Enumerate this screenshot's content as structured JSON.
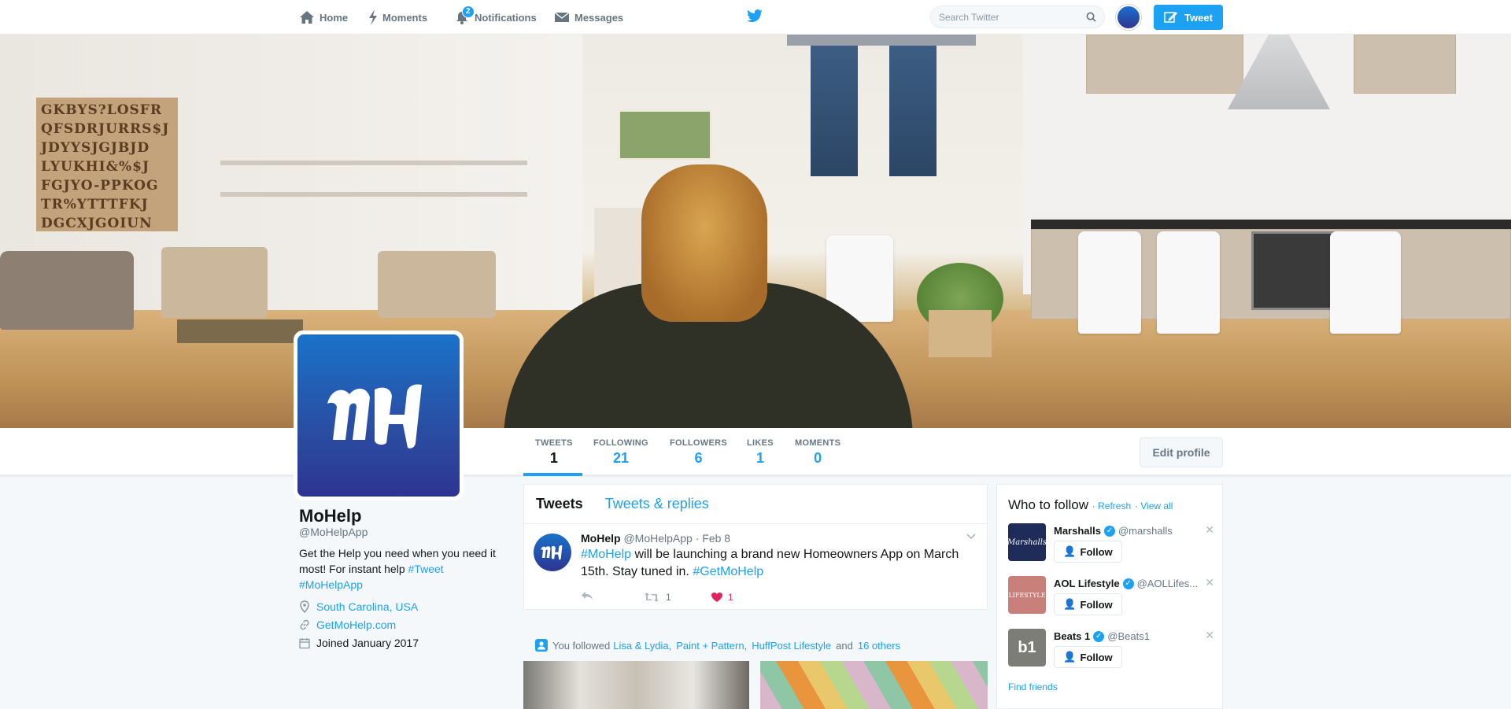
{
  "nav": {
    "home": "Home",
    "moments": "Moments",
    "notifications": "Notifications",
    "notifications_count": "2",
    "messages": "Messages",
    "search_placeholder": "Search Twitter",
    "tweet_button": "Tweet"
  },
  "banner": {
    "letter_art": "GKBYS?LOSFR QFSDRJURRS$J JDYYSJGJBJD LYUKHI&%$J FGJYO-PPKOG TR%YTTTFKJ DGCXJGOIUN"
  },
  "stats": [
    {
      "label": "TWEETS",
      "value": "1"
    },
    {
      "label": "FOLLOWING",
      "value": "21"
    },
    {
      "label": "FOLLOWERS",
      "value": "6"
    },
    {
      "label": "LIKES",
      "value": "1"
    },
    {
      "label": "MOMENTS",
      "value": "0"
    }
  ],
  "edit_profile": "Edit profile",
  "profile": {
    "name": "MoHelp",
    "handle": "@MoHelpApp",
    "bio_text": "Get the Help you need when you need it most! For instant help ",
    "bio_tag1": "#Tweet",
    "bio_tag2": "#MoHelpApp",
    "location": "South Carolina, USA",
    "website": "GetMoHelp.com",
    "joined": "Joined January 2017"
  },
  "timeline": {
    "tab_tweets": "Tweets",
    "tab_replies": "Tweets & replies",
    "tweet": {
      "name": "MoHelp",
      "handle": "@MoHelpApp",
      "date": "· Feb 8",
      "tag1": "#MoHelp",
      "text": " will be launching a brand new Homeowners App on March 15th. Stay tuned in. ",
      "tag2": "#GetMoHelp",
      "retweets": "1",
      "likes": "1"
    }
  },
  "followed": {
    "prefix": "You followed",
    "a": "Lisa & Lydia",
    "b": "Paint + Pattern",
    "c": "HuffPost Lifestyle",
    "and": "and",
    "others": "16 others"
  },
  "who_to_follow": {
    "title": "Who to follow",
    "refresh": "Refresh",
    "view_all": "View all",
    "follow_label": "Follow",
    "find_friends": "Find friends",
    "items": [
      {
        "name": "Marshalls",
        "handle": "@marshalls",
        "logo_text": "Marshalls",
        "color": "#1f2c5a"
      },
      {
        "name": "AOL Lifestyle",
        "handle": "@AOLLifes...",
        "logo_text": "LIFESTYLE",
        "color": "#c97f7a"
      },
      {
        "name": "Beats 1",
        "handle": "@Beats1",
        "logo_text": "b1",
        "color": "#7d7d78"
      }
    ]
  },
  "colors": {
    "accent": "#1da1f2",
    "background": "#f5f8fa",
    "like": "#e0245e"
  }
}
